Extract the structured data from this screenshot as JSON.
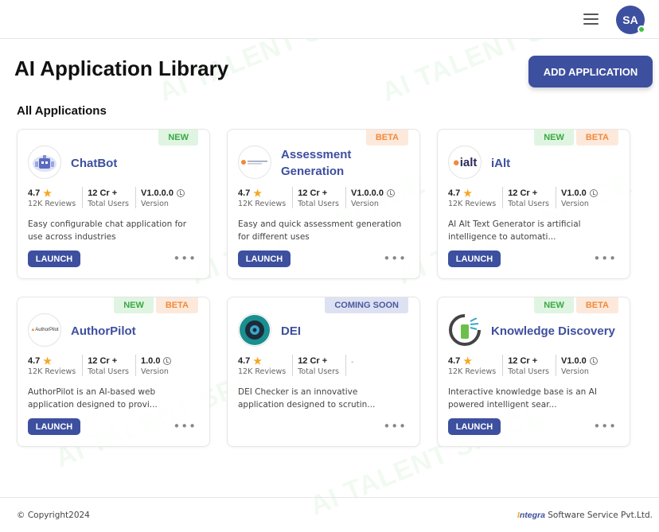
{
  "watermark": "AI TALENT SPACE",
  "header": {
    "avatar_initials": "SA",
    "menu_icon": "hamburger-menu-icon"
  },
  "page": {
    "title": "AI Application Library",
    "add_button": "ADD APPLICATION",
    "section_title": "All Applications"
  },
  "cards": [
    {
      "title": "ChatBot",
      "badges": [
        "NEW"
      ],
      "rating": "4.7",
      "reviews": "12K Reviews",
      "users": "12 Cr +",
      "users_label": "Total Users",
      "version": "V1.0.0.0",
      "version_label": "Version",
      "description_line1": "Easy configurable chat application for",
      "description_line2": "use across industries",
      "launch": "LAUNCH",
      "more": "•••"
    },
    {
      "title_line1": "Assessment",
      "title_line2": "Generation",
      "badges": [
        "BETA"
      ],
      "rating": "4.7",
      "reviews": "12K Reviews",
      "users": "12 Cr +",
      "users_label": "Total Users",
      "version": "V1.0.0.0",
      "version_label": "Version",
      "description_line1": "Easy and quick assessment generation",
      "description_line2": "for different uses",
      "launch": "LAUNCH",
      "more": "•••"
    },
    {
      "title": "iAlt",
      "logo_text": "ialt",
      "badges": [
        "NEW",
        "BETA"
      ],
      "rating": "4.7",
      "reviews": "12K Reviews",
      "users": "12 Cr +",
      "users_label": "Total Users",
      "version": "V1.0.0",
      "version_label": "Version",
      "description_line1": "AI Alt Text Generator is artificial",
      "description_line2": "intelligence to automati...",
      "launch": "LAUNCH",
      "more": "•••"
    },
    {
      "title": "AuthorPilot",
      "logo_text": "AuthorPilot",
      "badges": [
        "NEW",
        "BETA"
      ],
      "rating": "4.7",
      "reviews": "12K Reviews",
      "users": "12 Cr +",
      "users_label": "Total Users",
      "version": "1.0.0",
      "version_label": "Version",
      "description_line1": "AuthorPilot is an AI-based web",
      "description_line2": "application designed to provi...",
      "launch": "LAUNCH",
      "more": "•••"
    },
    {
      "title": "DEI",
      "badges": [
        "COMING SOON"
      ],
      "rating": "4.7",
      "reviews": "12K Reviews",
      "users": "12 Cr +",
      "users_label": "Total Users",
      "version_placeholder": "-",
      "description_line1": "DEI Checker is an innovative",
      "description_line2": "application designed to scrutin...",
      "more": "•••"
    },
    {
      "title": "Knowledge Discovery",
      "badges": [
        "NEW",
        "BETA"
      ],
      "rating": "4.7",
      "reviews": "12K Reviews",
      "users": "12 Cr +",
      "users_label": "Total Users",
      "version": "V1.0.0",
      "version_label": "Version",
      "description_line1": "Interactive knowledge base is an AI",
      "description_line2": "powered intelligent sear...",
      "launch": "LAUNCH",
      "more": "•••"
    }
  ],
  "footer": {
    "copyright": "© Copyright2024",
    "company_brand": "ntegra",
    "company_brand_initial": "I",
    "company_rest": " Software Service Pvt.Ltd."
  },
  "colors": {
    "primary": "#3d4f9f",
    "new_badge": "#3aa845",
    "beta_badge": "#f08a3c",
    "star": "#f5a623",
    "online": "#3ec23e"
  }
}
